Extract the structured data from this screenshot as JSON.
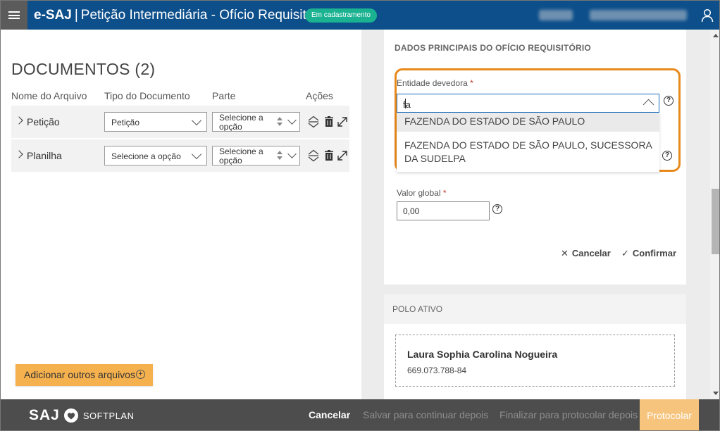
{
  "header": {
    "brand": "e-SAJ",
    "separator": "|",
    "title": "Petição Intermediária - Ofício Requisitório",
    "status_badge": "Em cadastramento",
    "colors": {
      "header_bg": "#0d4f8b",
      "menu_bg": "#5b5b5b",
      "badge": "#1ab291"
    }
  },
  "documents": {
    "title": "DOCUMENTOS (2)",
    "columns": [
      "Nome do Arquivo",
      "Tipo do Documento",
      "Parte",
      "Ações"
    ],
    "rows": [
      {
        "name": "Petição",
        "type": "Petição",
        "party": "Selecione a opção"
      },
      {
        "name": "Planilha",
        "type": "Selecione a opção",
        "party": "Selecione a opção"
      }
    ],
    "add_button": "Adicionar outros arquivos"
  },
  "form": {
    "section_title": "DADOS PRINCIPAIS DO OFÍCIO REQUISITÓRIO",
    "entidade_label": "Entidade devedora",
    "required_mark": "*",
    "entidade_value": "fa",
    "options": [
      "FAZENDA DO ESTADO DE SÃO PAULO",
      "FAZENDA DO ESTADO DE SÃO PAULO, SUCESSORA DA SUDELPA"
    ],
    "valor_label": "Valor global",
    "valor_value": "0,00",
    "help_glyph": "?",
    "cancel_label": "Cancelar",
    "confirm_label": "Confirmar",
    "highlight_color": "#e8891c"
  },
  "polo_ativo": {
    "title": "POLO ATIVO",
    "party_name": "Laura Sophia Carolina Nogueira",
    "party_doc": "669.073.788-84"
  },
  "footer": {
    "logo_saj": "SAJ",
    "logo_softplan": "SOFTPLAN",
    "cancel": "Cancelar",
    "save_later": "Salvar para continuar depois",
    "finalize_later": "Finalizar para protocolar depois",
    "protocolar": "Protocolar",
    "colors": {
      "footer_bg": "#4d4d4d",
      "protocolar_bg": "#f6c47d"
    }
  }
}
